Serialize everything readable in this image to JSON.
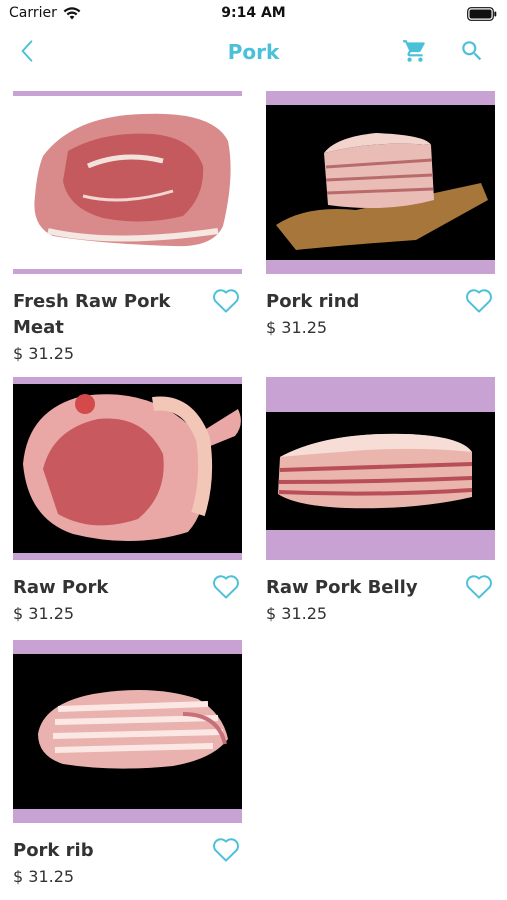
{
  "status_bar": {
    "carrier": "Carrier",
    "time": "9:14 AM"
  },
  "navbar": {
    "title": "Pork",
    "accent_color": "#4bc0d9"
  },
  "icons": {
    "back": "chevron-left-icon",
    "cart": "cart-icon",
    "search": "search-icon",
    "favorite": "heart-outline-icon"
  },
  "colors": {
    "card_frame": "#c8a2d2",
    "text": "#333333"
  },
  "products": [
    {
      "name": "Fresh Raw Pork Meat",
      "price": "$ 31.25"
    },
    {
      "name": "Pork rind",
      "price": "$ 31.25"
    },
    {
      "name": "Raw Pork",
      "price": "$ 31.25"
    },
    {
      "name": "Raw Pork Belly",
      "price": "$ 31.25"
    },
    {
      "name": "Pork rib",
      "price": "$ 31.25"
    }
  ]
}
